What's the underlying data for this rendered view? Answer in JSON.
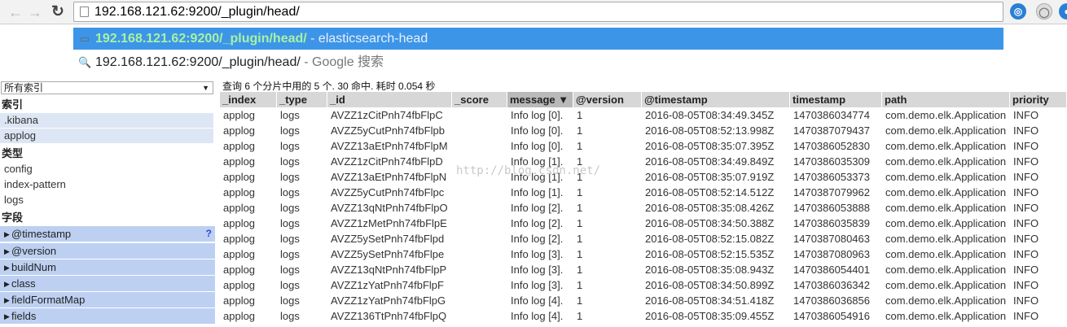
{
  "browser": {
    "url": "192.168.121.62:9200/_plugin/head/",
    "suggestions": [
      {
        "text": "192.168.121.62:9200/_plugin/head/",
        "desc": " - elasticsearch-head",
        "icon": "page-icon"
      },
      {
        "text": "192.168.121.62:9200/_plugin/head/",
        "desc": " - Google 搜索",
        "icon": "search-icon"
      }
    ]
  },
  "sidebar": {
    "index_select": "所有索引",
    "indices_heading": "索引",
    "indices": [
      ".kibana",
      "applog"
    ],
    "types_heading": "类型",
    "types": [
      "config",
      "index-pattern",
      "logs"
    ],
    "fields_heading": "字段",
    "fields": [
      "@timestamp",
      "@version",
      "buildNum",
      "class",
      "fieldFormatMap",
      "fields"
    ],
    "help": "?"
  },
  "results": {
    "summary": "查询 6 个分片中用的 5 个. 30 命中. 耗时 0.054 秒",
    "columns": [
      "_index",
      "_type",
      "_id",
      "_score",
      "message ▼",
      "@version",
      "@timestamp",
      "timestamp",
      "path",
      "priority"
    ],
    "rows": [
      [
        "applog",
        "logs",
        "AVZZ1zCitPnh74fbFlpC",
        "",
        "Info log [0].",
        "1",
        "2016-08-05T08:34:49.345Z",
        "1470386034774",
        "com.demo.elk.Application",
        "INFO"
      ],
      [
        "applog",
        "logs",
        "AVZZ5yCutPnh74fbFlpb",
        "",
        "Info log [0].",
        "1",
        "2016-08-05T08:52:13.998Z",
        "1470387079437",
        "com.demo.elk.Application",
        "INFO"
      ],
      [
        "applog",
        "logs",
        "AVZZ13aEtPnh74fbFlpM",
        "",
        "Info log [0].",
        "1",
        "2016-08-05T08:35:07.395Z",
        "1470386052830",
        "com.demo.elk.Application",
        "INFO"
      ],
      [
        "applog",
        "logs",
        "AVZZ1zCitPnh74fbFlpD",
        "",
        "Info log [1].",
        "1",
        "2016-08-05T08:34:49.849Z",
        "1470386035309",
        "com.demo.elk.Application",
        "INFO"
      ],
      [
        "applog",
        "logs",
        "AVZZ13aEtPnh74fbFlpN",
        "",
        "Info log [1].",
        "1",
        "2016-08-05T08:35:07.919Z",
        "1470386053373",
        "com.demo.elk.Application",
        "INFO"
      ],
      [
        "applog",
        "logs",
        "AVZZ5yCutPnh74fbFlpc",
        "",
        "Info log [1].",
        "1",
        "2016-08-05T08:52:14.512Z",
        "1470387079962",
        "com.demo.elk.Application",
        "INFO"
      ],
      [
        "applog",
        "logs",
        "AVZZ13qNtPnh74fbFlpO",
        "",
        "Info log [2].",
        "1",
        "2016-08-05T08:35:08.426Z",
        "1470386053888",
        "com.demo.elk.Application",
        "INFO"
      ],
      [
        "applog",
        "logs",
        "AVZZ1zMetPnh74fbFlpE",
        "",
        "Info log [2].",
        "1",
        "2016-08-05T08:34:50.388Z",
        "1470386035839",
        "com.demo.elk.Application",
        "INFO"
      ],
      [
        "applog",
        "logs",
        "AVZZ5ySetPnh74fbFlpd",
        "",
        "Info log [2].",
        "1",
        "2016-08-05T08:52:15.082Z",
        "1470387080463",
        "com.demo.elk.Application",
        "INFO"
      ],
      [
        "applog",
        "logs",
        "AVZZ5ySetPnh74fbFlpe",
        "",
        "Info log [3].",
        "1",
        "2016-08-05T08:52:15.535Z",
        "1470387080963",
        "com.demo.elk.Application",
        "INFO"
      ],
      [
        "applog",
        "logs",
        "AVZZ13qNtPnh74fbFlpP",
        "",
        "Info log [3].",
        "1",
        "2016-08-05T08:35:08.943Z",
        "1470386054401",
        "com.demo.elk.Application",
        "INFO"
      ],
      [
        "applog",
        "logs",
        "AVZZ1zYatPnh74fbFlpF",
        "",
        "Info log [3].",
        "1",
        "2016-08-05T08:34:50.899Z",
        "1470386036342",
        "com.demo.elk.Application",
        "INFO"
      ],
      [
        "applog",
        "logs",
        "AVZZ1zYatPnh74fbFlpG",
        "",
        "Info log [4].",
        "1",
        "2016-08-05T08:34:51.418Z",
        "1470386036856",
        "com.demo.elk.Application",
        "INFO"
      ],
      [
        "applog",
        "logs",
        "AVZZ136TtPnh74fbFlpQ",
        "",
        "Info log [4].",
        "1",
        "2016-08-05T08:35:09.455Z",
        "1470386054916",
        "com.demo.elk.Application",
        "INFO"
      ]
    ]
  },
  "watermark": "http://blog.csdn.net/"
}
